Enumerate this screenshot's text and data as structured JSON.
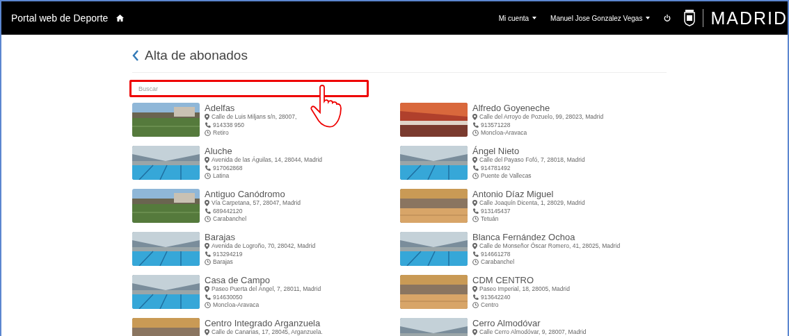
{
  "header": {
    "title": "Portal web de Deporte",
    "menu": [
      {
        "label": "Mi cuenta"
      },
      {
        "label": "Manuel Jose Gonzalez Vegas"
      }
    ],
    "logo_text": "MADRID"
  },
  "page": {
    "title": "Alta de abonados",
    "search": {
      "placeholder": "Buscar"
    }
  },
  "centers": [
    {
      "name": "Adelfas",
      "address": "Calle de Luis Miljans s/n, 28007,",
      "phone": "914338 950",
      "district": "Retiro",
      "kind": "field"
    },
    {
      "name": "Alfredo Goyeneche",
      "address": "Calle del Arroyo de Pozuelo, 99, 28023, Madrid",
      "phone": "913571228",
      "district": "Moncloa-Aravaca",
      "kind": "redhall"
    },
    {
      "name": "Aluche",
      "address": "Avenida de las Águilas, 14, 28044, Madrid",
      "phone": "917062868",
      "district": "Latina",
      "kind": "pool"
    },
    {
      "name": "Ángel Nieto",
      "address": "Calle del Payaso Fofó, 7, 28018, Madrid",
      "phone": "914781492",
      "district": "Puente de Vallecas",
      "kind": "pool"
    },
    {
      "name": "Antiguo Canódromo",
      "address": "Vía Carpetana, 57, 28047, Madrid",
      "phone": "689442120",
      "district": "Carabanchel",
      "kind": "field"
    },
    {
      "name": "Antonio Díaz Miguel",
      "address": "Calle Joaquín Dicenta, 1, 28029, Madrid",
      "phone": "913145437",
      "district": "Tetuán",
      "kind": "hall"
    },
    {
      "name": "Barajas",
      "address": "Avenida de Logroño, 70, 28042, Madrid",
      "phone": "913294219",
      "district": "Barajas",
      "kind": "pool"
    },
    {
      "name": "Blanca Fernández Ochoa",
      "address": "Calle de Monseñor Óscar Romero, 41, 28025, Madrid",
      "phone": "914661278",
      "district": "Carabanchel",
      "kind": "pool"
    },
    {
      "name": "Casa de Campo",
      "address": "Paseo Puerta del Ángel, 7, 28011, Madrid",
      "phone": "914630050",
      "district": "Moncloa-Aravaca",
      "kind": "pool"
    },
    {
      "name": "CDM CENTRO",
      "address": "Paseo Imperial, 18, 28005, Madrid",
      "phone": "913642240",
      "district": "Centro",
      "kind": "hall"
    },
    {
      "name": "Centro Integrado Arganzuela",
      "address": "Calle de Canarias, 17, 28045, Arganzuela.",
      "kind": "hall"
    },
    {
      "name": "Cerro Almodóvar",
      "address": "Calle Cerro Almodóvar, 9, 28007, Madrid",
      "kind": "pool"
    }
  ]
}
